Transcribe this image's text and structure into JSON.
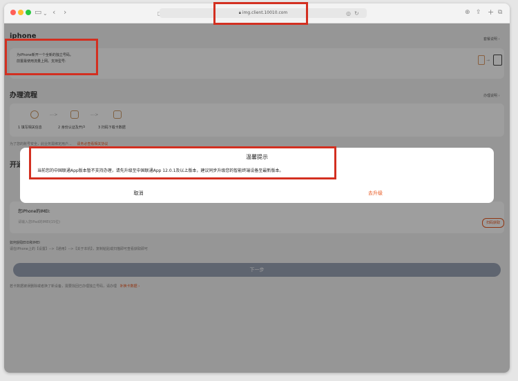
{
  "browser": {
    "url": "img.client.10010.com",
    "traffic_colors": [
      "#ff5f57",
      "#febc2e",
      "#28c840"
    ]
  },
  "page": {
    "title": "iphone",
    "pkg_link": "套餐说明 ›",
    "intro_line1": "为iPhone新开一个全新的独立号码。",
    "intro_line2": "前置最使用流量上网。支持型号:",
    "process_title": "办理流程",
    "process_link": "办理说明 ›",
    "steps": [
      "1 填写相关信息",
      "2 身份认证及开户",
      "3 扫码下载卡数据"
    ],
    "notice": "为了您的账号安全，此业务需绑定用户...",
    "notice_link": "请务必查看相关协议",
    "open_title": "开通",
    "imei_label": "您iPhone的IMEI:",
    "imei_placeholder": "请输入您iPad的IMEI(15位)",
    "scan_btn": "扫码获取",
    "help_title": "如何获取EID和IMEI",
    "help_text": "请在iPhone上的【设置】-->【通用】-->【关于本机】，复制粘贴或扫描即可查看获取即可",
    "next_btn": "下一步",
    "footer": "若卡数据被误删除或者换了新设备，需要找回已办理独立号码，请办理",
    "footer_link": "补换卡数据 ›"
  },
  "dialog": {
    "title": "温馨提示",
    "message": "当前您的中国联通App版本暂不支持办理，请先升级至中国联通App 12.0.1及以上版本，建议同步升级您的智能终端设备至最新版本。",
    "cancel": "取消",
    "upgrade": "去升级"
  },
  "colors": {
    "accent": "#e8541b",
    "annotation": "#d32f20"
  }
}
